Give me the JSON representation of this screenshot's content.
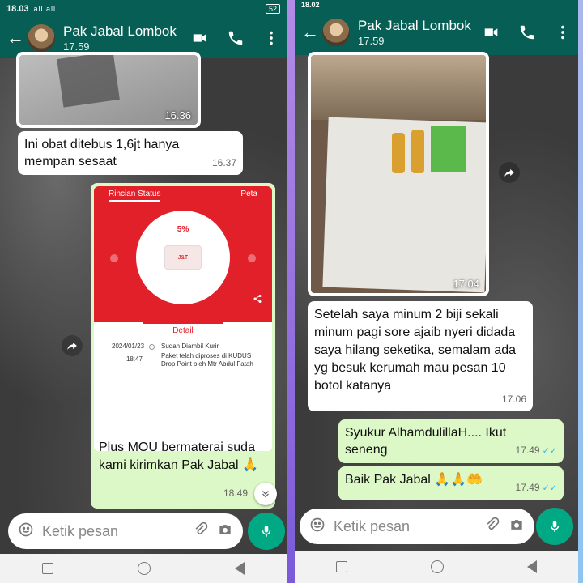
{
  "left": {
    "status": {
      "time": "18.03",
      "signal": "all all",
      "battery": "52"
    },
    "header": {
      "name": "Pak Jabal Lombok",
      "subtitle": "17.59"
    },
    "messages": {
      "photo_time": "16.36",
      "msg1": {
        "text": "Ini obat ditebus 1,6jt hanya mempan sesaat",
        "time": "16.37"
      },
      "card": {
        "tab1": "Rincian Status",
        "tab2": "Peta",
        "percent": "5%",
        "logo_text": "J&T",
        "status_label": "Sudah Diambil Kurir",
        "detail_tab": "Detail",
        "date": "2024/01/23",
        "clock": "18:47",
        "event_title": "Sudah Diambil Kurir",
        "event_desc": "Paket telah diproses di KUDUS Drop Point oleh Mtr Abdul Fatah"
      },
      "msg2": {
        "text": "Plus MOU bermaterai suda kami kirimkan Pak Jabal 🙏",
        "time": "18.49"
      }
    },
    "composer": {
      "placeholder": "Ketik pesan"
    }
  },
  "right": {
    "status": {
      "time": "18.02"
    },
    "header": {
      "name": "Pak Jabal Lombok",
      "subtitle": "17.59"
    },
    "messages": {
      "photo_time": "17.04",
      "msg1": {
        "text": "Setelah saya minum 2 biji sekali minum pagi sore ajaib nyeri didada saya hilang seketika, semalam ada yg besuk kerumah mau pesan 10 botol katanya",
        "time": "17.06"
      },
      "msg2": {
        "text": "Syukur AlhamdulillaH.... Ikut seneng",
        "time": "17.49"
      },
      "msg3": {
        "text": "Baik Pak Jabal 🙏🙏🤲",
        "time": "17.49"
      }
    },
    "composer": {
      "placeholder": "Ketik pesan"
    }
  },
  "colors": {
    "header": "#075e54",
    "outgoing": "#dcf8c6",
    "incoming": "#ffffff",
    "accent": "#00a884",
    "ticks": "#34b7f1",
    "jnt_red": "#e2202a"
  },
  "icons": [
    "back-arrow-icon",
    "video-call-icon",
    "phone-icon",
    "more-vert-icon",
    "emoji-icon",
    "attach-icon",
    "camera-icon",
    "mic-icon",
    "forward-icon",
    "share-icon",
    "scroll-down-icon"
  ]
}
